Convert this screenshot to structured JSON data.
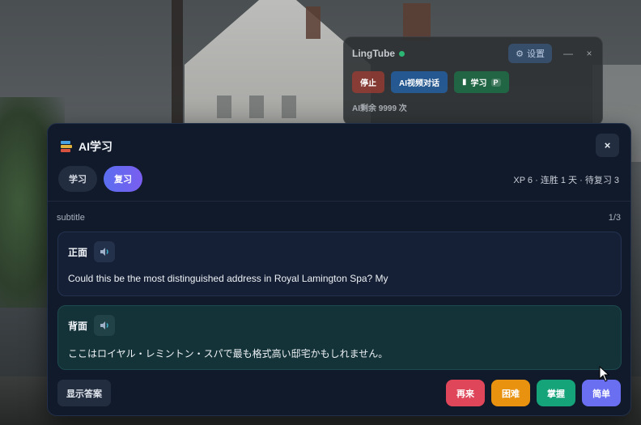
{
  "toolbar": {
    "title": "LingTube",
    "settings_label": "设置",
    "minimize_label": "—",
    "close_label": "×",
    "stop_label": "停止",
    "ai_chat_label": "AI视频对话",
    "study_label": "学习",
    "study_badge": "P",
    "remaining": "AI剩余 9999 次"
  },
  "modal": {
    "title": "AI学习",
    "close_label": "×",
    "tabs": [
      {
        "label": "学习",
        "active": false
      },
      {
        "label": "复习",
        "active": true
      }
    ],
    "stats": "XP 6 · 连胜 1 天 · 待复习 3",
    "source": "subtitle",
    "counter": "1/3",
    "front": {
      "label": "正面",
      "text": "Could this be the most distinguished address in Royal Lamington Spa? My"
    },
    "back": {
      "label": "背面",
      "text": "ここはロイヤル・レミントン・スパで最も格式高い邸宅かもしれません。"
    },
    "show_answer_label": "显示答案",
    "grades": {
      "again": "再来",
      "hard": "困难",
      "good": "掌握",
      "easy": "简单"
    }
  },
  "colors": {
    "accent": "#6a6ff2",
    "again": "#e0465a",
    "hard": "#e8920f",
    "good": "#15a37a",
    "modal_bg": "#111a2a"
  },
  "icons": [
    "books-icon",
    "speaker-icon",
    "close-icon",
    "gear-icon",
    "mouse-cursor-icon"
  ]
}
